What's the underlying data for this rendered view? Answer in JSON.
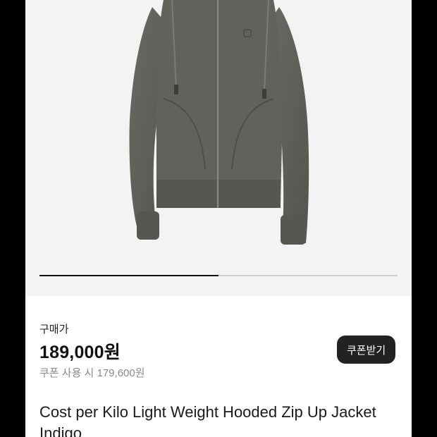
{
  "gallery": {
    "image_subject": "gray hooded zip-up jacket",
    "progress_fraction": 0.5
  },
  "pricing": {
    "label": "구매가",
    "price": "189,000원",
    "coupon_price": "쿠폰 사용 시 179,600원",
    "coupon_button": "쿠폰받기"
  },
  "product": {
    "title": "Cost per Kilo Light Weight Hooded Zip Up Jacket Indigo"
  }
}
